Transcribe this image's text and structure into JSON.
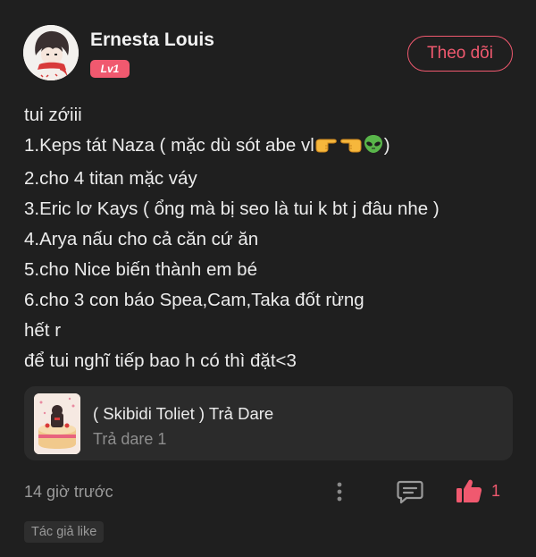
{
  "author": {
    "name": "Ernesta Louis",
    "level_badge": "Lv1",
    "follow_label": "Theo dõi"
  },
  "post": {
    "lines": [
      "tui zớiii",
      "1.Keps tát Naza ( mặc dù sót abe vl",
      "2.cho 4 titan mặc váy",
      "3.Eric lơ Kays ( ổng mà bị seo là tui k bt j đâu nhe )",
      "4.Arya nấu cho cả căn cứ ăn",
      "5.cho Nice biến thành em bé",
      "6.cho 3 con báo Spea,Cam,Taka đốt rừng",
      "hết r",
      "để tui nghĩ tiếp bao h có thì đặt<3"
    ],
    "line2_suffix": ")",
    "emojis": [
      "pointing-right-hand",
      "pointing-left-hand",
      "alien-face"
    ]
  },
  "linked_dare": {
    "title": "( Skibidi Toliet ) Trả Dare",
    "subtitle": "Trả dare 1"
  },
  "footer": {
    "timestamp": "14 giờ trước",
    "like_count": "1",
    "author_like_tag": "Tác giả like"
  },
  "colors": {
    "background": "#1f1f1f",
    "accent": "#f0596f",
    "card": "#2b2b2b",
    "muted_text": "#9a9a9a"
  },
  "icons": {
    "more": "vertical-dots-icon",
    "comment": "comment-bubble-icon",
    "like": "thumbs-up-icon"
  }
}
